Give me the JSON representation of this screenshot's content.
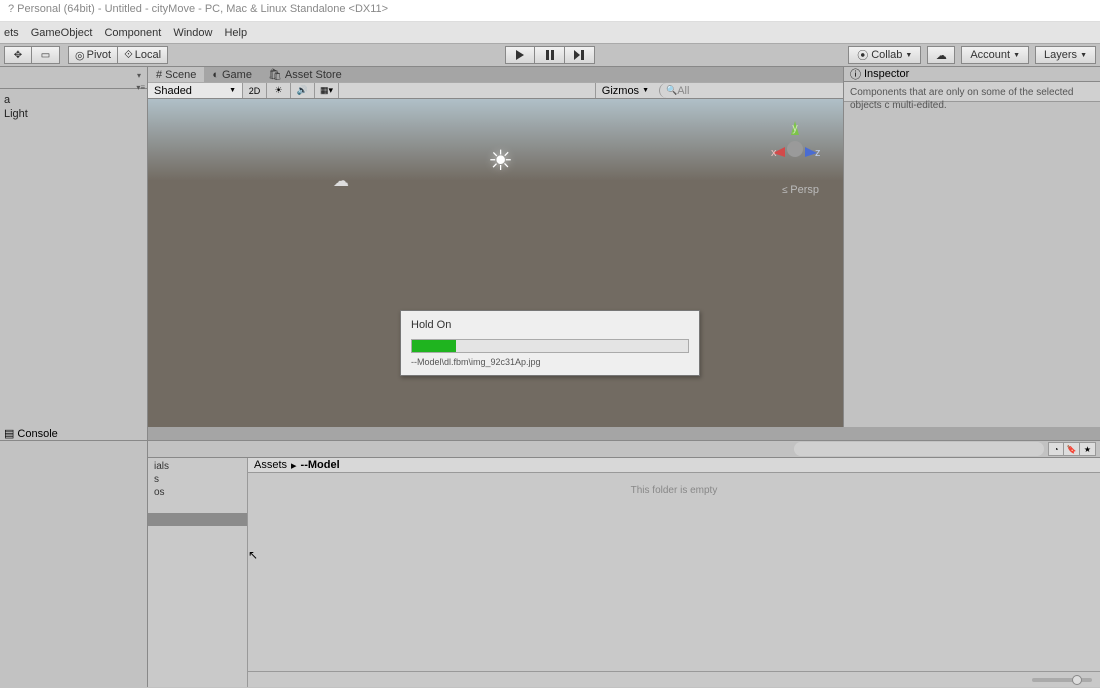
{
  "window": {
    "title": "? Personal (64bit) - Untitled - cityMove - PC, Mac & Linux Standalone <DX11>"
  },
  "menu": {
    "items": [
      "ets",
      "GameObject",
      "Component",
      "Window",
      "Help"
    ]
  },
  "toolbar": {
    "pivot": "Pivot",
    "local": "Local",
    "collab": "Collab",
    "account": "Account",
    "layers": "Layers"
  },
  "scene": {
    "tabs": {
      "scene": "Scene",
      "game": "Game",
      "asset_store": "Asset Store"
    },
    "shading": "Shaded",
    "mode2d": "2D",
    "gizmos": "Gizmos",
    "search_placeholder": "All",
    "persp": "Persp"
  },
  "hierarchy": {
    "items": [
      "a",
      "Light"
    ]
  },
  "inspector": {
    "tab": "Inspector",
    "message": "Components that are only on some of the selected objects c multi-edited."
  },
  "console": {
    "tab": "Console"
  },
  "project": {
    "tree": [
      "ials",
      "s",
      "os"
    ],
    "breadcrumb": {
      "root": "Assets",
      "current": "--Model"
    },
    "empty_msg": "This folder is empty"
  },
  "dialog": {
    "title": "Hold On",
    "progress_pct": 16,
    "file": "--Model\\dl.fbm\\img_92c31Ap.jpg"
  }
}
